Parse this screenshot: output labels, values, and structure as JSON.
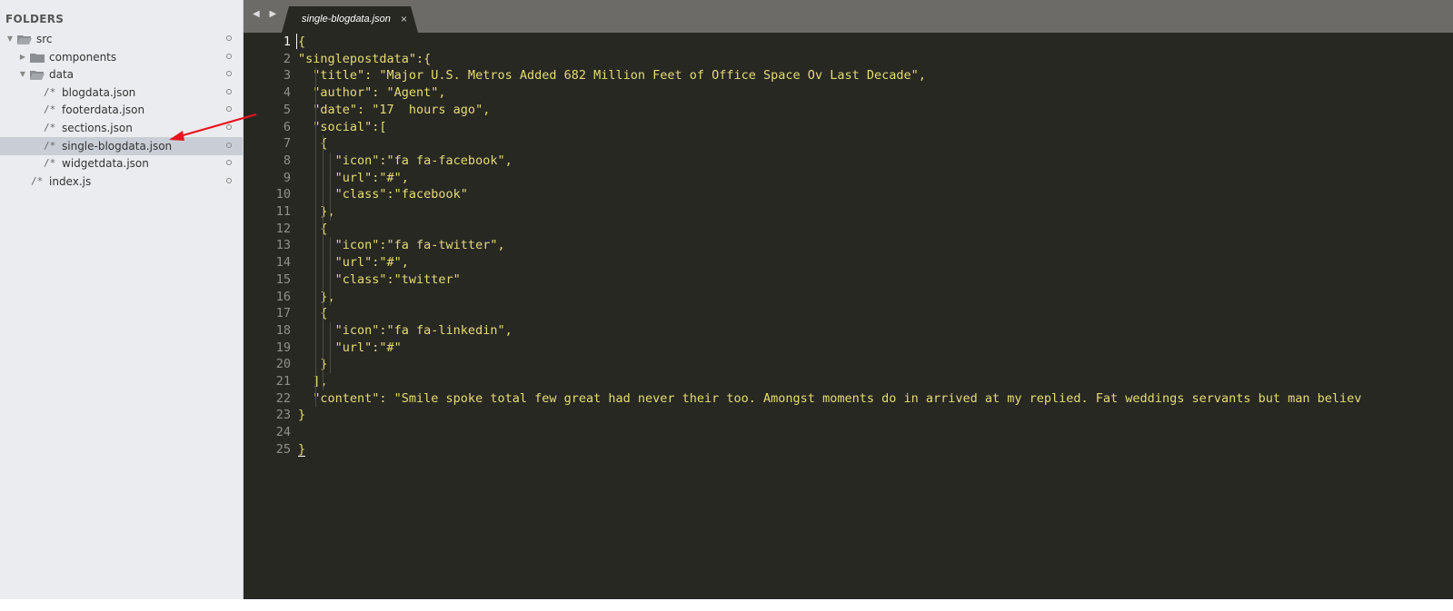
{
  "sidebar": {
    "title": "FOLDERS",
    "items": [
      {
        "label": "src",
        "type": "folder",
        "expanded": true,
        "indent": 0
      },
      {
        "label": "components",
        "type": "folder",
        "expanded": false,
        "indent": 1
      },
      {
        "label": "data",
        "type": "folder",
        "expanded": true,
        "indent": 1
      },
      {
        "label": "blogdata.json",
        "type": "file",
        "indent": 2,
        "prefix": "/*"
      },
      {
        "label": "footerdata.json",
        "type": "file",
        "indent": 2,
        "prefix": "/*"
      },
      {
        "label": "sections.json",
        "type": "file",
        "indent": 2,
        "prefix": "/*"
      },
      {
        "label": "single-blogdata.json",
        "type": "file",
        "indent": 2,
        "prefix": "/*",
        "selected": true
      },
      {
        "label": "widgetdata.json",
        "type": "file",
        "indent": 2,
        "prefix": "/*"
      },
      {
        "label": "index.js",
        "type": "file",
        "indent": 1,
        "prefix": "/*"
      }
    ]
  },
  "tabbar": {
    "nav": "◀ ▶",
    "tab_label": "single-blogdata.json",
    "close": "×"
  },
  "editor": {
    "active_line": 1,
    "lines": [
      {
        "n": "1",
        "text": "{"
      },
      {
        "n": "2",
        "text": "\"singlepostdata\":{"
      },
      {
        "n": "3",
        "text": "  \"title\": \"Major U.S. Metros Added 682 Million Feet of Office Space Ov Last Decade\","
      },
      {
        "n": "4",
        "text": "  \"author\": \"Agent\","
      },
      {
        "n": "5",
        "text": "  \"date\": \"17  hours ago\","
      },
      {
        "n": "6",
        "text": "  \"social\":["
      },
      {
        "n": "7",
        "text": "   {"
      },
      {
        "n": "8",
        "text": "     \"icon\":\"fa fa-facebook\","
      },
      {
        "n": "9",
        "text": "     \"url\":\"#\","
      },
      {
        "n": "10",
        "text": "     \"class\":\"facebook\""
      },
      {
        "n": "11",
        "text": "   },"
      },
      {
        "n": "12",
        "text": "   {"
      },
      {
        "n": "13",
        "text": "     \"icon\":\"fa fa-twitter\","
      },
      {
        "n": "14",
        "text": "     \"url\":\"#\","
      },
      {
        "n": "15",
        "text": "     \"class\":\"twitter\""
      },
      {
        "n": "16",
        "text": "   },"
      },
      {
        "n": "17",
        "text": "   {"
      },
      {
        "n": "18",
        "text": "     \"icon\":\"fa fa-linkedin\","
      },
      {
        "n": "19",
        "text": "     \"url\":\"#\""
      },
      {
        "n": "20",
        "text": "   }"
      },
      {
        "n": "21",
        "text": "  ],"
      },
      {
        "n": "22",
        "text": "  \"content\": \"Smile spoke total few great had never their too. Amongst moments do in arrived at my replied. Fat weddings servants but man believ"
      },
      {
        "n": "23",
        "text": "}"
      },
      {
        "n": "24",
        "text": ""
      },
      {
        "n": "25",
        "text": "}"
      }
    ]
  },
  "colors": {
    "editor_bg": "#272822",
    "string": "#e6db74",
    "plain": "#f8f8f2",
    "line_number": "#8f908a",
    "tabbar_bg": "#6c6b67",
    "sidebar_bg": "#eaecef",
    "selected_row": "#c9ced6",
    "annotation_arrow": "#e8141c"
  }
}
